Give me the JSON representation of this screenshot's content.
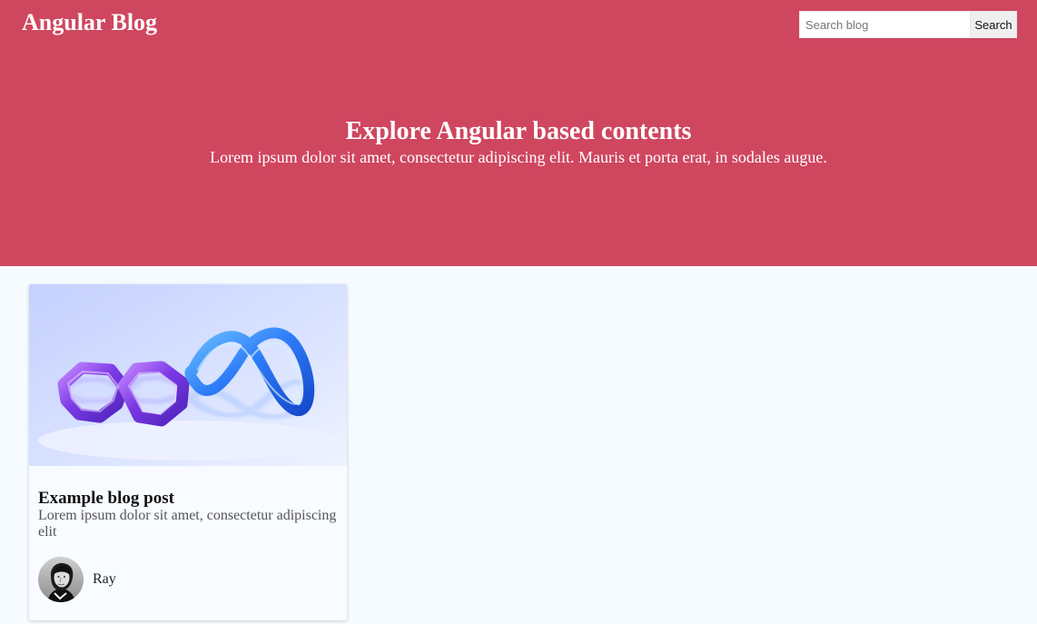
{
  "header": {
    "brand": "Angular Blog",
    "search_placeholder": "Search blog",
    "search_button": "Search"
  },
  "hero": {
    "title": "Explore Angular based contents",
    "subtitle": "Lorem ipsum dolor sit amet, consectetur adipiscing elit. Mauris et porta erat, in sodales augue."
  },
  "posts": [
    {
      "title": "Example blog post",
      "description": "Lorem ipsum dolor sit amet, consectetur adipiscing elit",
      "author": "Ray",
      "image_icon": "interlocked-loops-illustration",
      "avatar_icon": "author-avatar"
    }
  ],
  "colors": {
    "hero_background": "#cf465f",
    "page_background": "#f6fbff",
    "text_primary": "#111111",
    "text_secondary": "#555555",
    "search_button_background": "#efefef"
  }
}
